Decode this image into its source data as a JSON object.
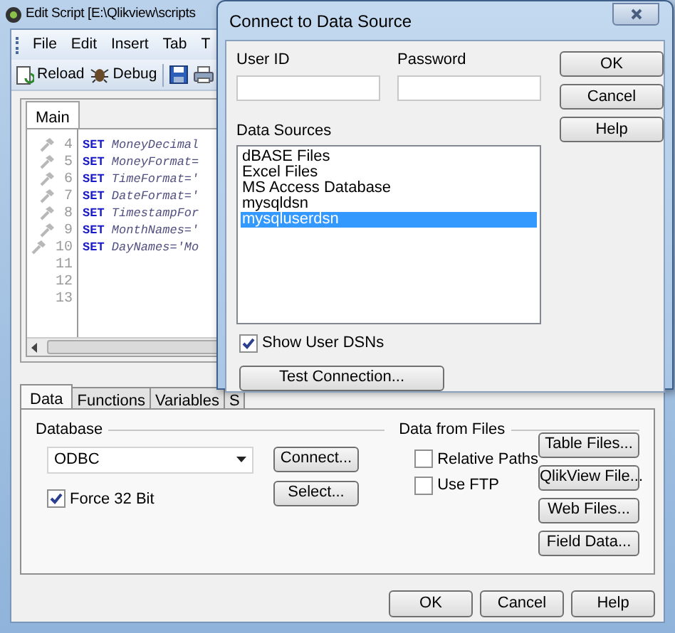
{
  "window": {
    "title": "Edit Script [E:\\Qlikview\\scripts"
  },
  "menu": [
    "File",
    "Edit",
    "Insert",
    "Tab",
    "T"
  ],
  "toolbar": [
    {
      "kind": "reload",
      "label": "Reload"
    },
    {
      "kind": "debug",
      "label": "Debug"
    },
    {
      "kind": "save"
    },
    {
      "kind": "print"
    }
  ],
  "script_tabs": [
    {
      "label": "Main",
      "selected": true
    }
  ],
  "editor": {
    "lines": [
      {
        "number": "4",
        "keyword": "SET",
        "text": "MoneyDecimal"
      },
      {
        "number": "5",
        "keyword": "SET",
        "text": "MoneyFormat="
      },
      {
        "number": "6",
        "keyword": "SET",
        "text": "TimeFormat='"
      },
      {
        "number": "7",
        "keyword": "SET",
        "text": "DateFormat='"
      },
      {
        "number": "8",
        "keyword": "SET",
        "text": "TimestampFor"
      },
      {
        "number": "9",
        "keyword": "SET",
        "text": "MonthNames='"
      },
      {
        "number": "10",
        "keyword": "SET",
        "text": "DayNames='Mo"
      },
      {
        "number": "11"
      },
      {
        "number": "12"
      },
      {
        "number": "13"
      }
    ]
  },
  "panel_tabs": [
    {
      "label": "Data",
      "selected": true
    },
    {
      "label": "Functions",
      "selected": false
    },
    {
      "label": "Variables",
      "selected": false
    },
    {
      "label": "S",
      "selected": false
    }
  ],
  "database": {
    "label": "Database",
    "driver": "ODBC",
    "force_32_bit": {
      "label": "Force 32 Bit",
      "checked": true
    },
    "buttons": [
      "Connect...",
      "Select..."
    ]
  },
  "data_from_files": {
    "label": "Data from Files",
    "options": [
      {
        "label": "Relative Paths",
        "checked": false
      },
      {
        "label": "Use FTP",
        "checked": false
      }
    ],
    "buttons": [
      "Table Files...",
      "QlikView File...",
      "Web Files...",
      "Field Data..."
    ]
  },
  "buttons": [
    "OK",
    "Cancel",
    "Help"
  ],
  "dialog": {
    "title": "Connect to Data Source",
    "user_id": {
      "label": "User ID"
    },
    "password": {
      "label": "Password"
    },
    "buttons": [
      "OK",
      "Cancel",
      "Help"
    ],
    "data_sources": {
      "label": "Data Sources",
      "items": [
        {
          "label": "dBASE Files",
          "selected": false
        },
        {
          "label": "Excel Files",
          "selected": false
        },
        {
          "label": "MS Access Database",
          "selected": false
        },
        {
          "label": "mysqldsn",
          "selected": false
        },
        {
          "label": "mysqluserdsn",
          "selected": true
        }
      ]
    },
    "show_user_dsns": {
      "label": "Show User DSNs",
      "checked": true
    },
    "test_button": "Test Connection..."
  }
}
